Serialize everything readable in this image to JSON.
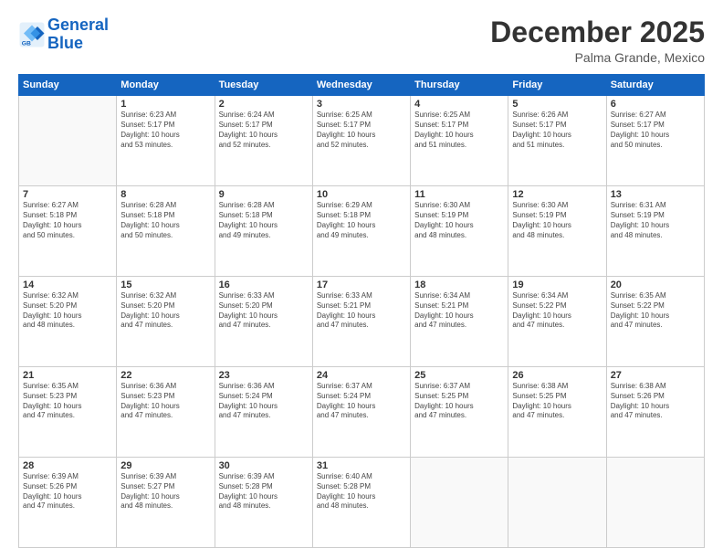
{
  "header": {
    "logo_line1": "General",
    "logo_line2": "Blue",
    "month": "December 2025",
    "location": "Palma Grande, Mexico"
  },
  "weekdays": [
    "Sunday",
    "Monday",
    "Tuesday",
    "Wednesday",
    "Thursday",
    "Friday",
    "Saturday"
  ],
  "weeks": [
    [
      {
        "day": "",
        "info": ""
      },
      {
        "day": "1",
        "info": "Sunrise: 6:23 AM\nSunset: 5:17 PM\nDaylight: 10 hours\nand 53 minutes."
      },
      {
        "day": "2",
        "info": "Sunrise: 6:24 AM\nSunset: 5:17 PM\nDaylight: 10 hours\nand 52 minutes."
      },
      {
        "day": "3",
        "info": "Sunrise: 6:25 AM\nSunset: 5:17 PM\nDaylight: 10 hours\nand 52 minutes."
      },
      {
        "day": "4",
        "info": "Sunrise: 6:25 AM\nSunset: 5:17 PM\nDaylight: 10 hours\nand 51 minutes."
      },
      {
        "day": "5",
        "info": "Sunrise: 6:26 AM\nSunset: 5:17 PM\nDaylight: 10 hours\nand 51 minutes."
      },
      {
        "day": "6",
        "info": "Sunrise: 6:27 AM\nSunset: 5:17 PM\nDaylight: 10 hours\nand 50 minutes."
      }
    ],
    [
      {
        "day": "7",
        "info": "Sunrise: 6:27 AM\nSunset: 5:18 PM\nDaylight: 10 hours\nand 50 minutes."
      },
      {
        "day": "8",
        "info": "Sunrise: 6:28 AM\nSunset: 5:18 PM\nDaylight: 10 hours\nand 50 minutes."
      },
      {
        "day": "9",
        "info": "Sunrise: 6:28 AM\nSunset: 5:18 PM\nDaylight: 10 hours\nand 49 minutes."
      },
      {
        "day": "10",
        "info": "Sunrise: 6:29 AM\nSunset: 5:18 PM\nDaylight: 10 hours\nand 49 minutes."
      },
      {
        "day": "11",
        "info": "Sunrise: 6:30 AM\nSunset: 5:19 PM\nDaylight: 10 hours\nand 48 minutes."
      },
      {
        "day": "12",
        "info": "Sunrise: 6:30 AM\nSunset: 5:19 PM\nDaylight: 10 hours\nand 48 minutes."
      },
      {
        "day": "13",
        "info": "Sunrise: 6:31 AM\nSunset: 5:19 PM\nDaylight: 10 hours\nand 48 minutes."
      }
    ],
    [
      {
        "day": "14",
        "info": "Sunrise: 6:32 AM\nSunset: 5:20 PM\nDaylight: 10 hours\nand 48 minutes."
      },
      {
        "day": "15",
        "info": "Sunrise: 6:32 AM\nSunset: 5:20 PM\nDaylight: 10 hours\nand 47 minutes."
      },
      {
        "day": "16",
        "info": "Sunrise: 6:33 AM\nSunset: 5:20 PM\nDaylight: 10 hours\nand 47 minutes."
      },
      {
        "day": "17",
        "info": "Sunrise: 6:33 AM\nSunset: 5:21 PM\nDaylight: 10 hours\nand 47 minutes."
      },
      {
        "day": "18",
        "info": "Sunrise: 6:34 AM\nSunset: 5:21 PM\nDaylight: 10 hours\nand 47 minutes."
      },
      {
        "day": "19",
        "info": "Sunrise: 6:34 AM\nSunset: 5:22 PM\nDaylight: 10 hours\nand 47 minutes."
      },
      {
        "day": "20",
        "info": "Sunrise: 6:35 AM\nSunset: 5:22 PM\nDaylight: 10 hours\nand 47 minutes."
      }
    ],
    [
      {
        "day": "21",
        "info": "Sunrise: 6:35 AM\nSunset: 5:23 PM\nDaylight: 10 hours\nand 47 minutes."
      },
      {
        "day": "22",
        "info": "Sunrise: 6:36 AM\nSunset: 5:23 PM\nDaylight: 10 hours\nand 47 minutes."
      },
      {
        "day": "23",
        "info": "Sunrise: 6:36 AM\nSunset: 5:24 PM\nDaylight: 10 hours\nand 47 minutes."
      },
      {
        "day": "24",
        "info": "Sunrise: 6:37 AM\nSunset: 5:24 PM\nDaylight: 10 hours\nand 47 minutes."
      },
      {
        "day": "25",
        "info": "Sunrise: 6:37 AM\nSunset: 5:25 PM\nDaylight: 10 hours\nand 47 minutes."
      },
      {
        "day": "26",
        "info": "Sunrise: 6:38 AM\nSunset: 5:25 PM\nDaylight: 10 hours\nand 47 minutes."
      },
      {
        "day": "27",
        "info": "Sunrise: 6:38 AM\nSunset: 5:26 PM\nDaylight: 10 hours\nand 47 minutes."
      }
    ],
    [
      {
        "day": "28",
        "info": "Sunrise: 6:39 AM\nSunset: 5:26 PM\nDaylight: 10 hours\nand 47 minutes."
      },
      {
        "day": "29",
        "info": "Sunrise: 6:39 AM\nSunset: 5:27 PM\nDaylight: 10 hours\nand 48 minutes."
      },
      {
        "day": "30",
        "info": "Sunrise: 6:39 AM\nSunset: 5:28 PM\nDaylight: 10 hours\nand 48 minutes."
      },
      {
        "day": "31",
        "info": "Sunrise: 6:40 AM\nSunset: 5:28 PM\nDaylight: 10 hours\nand 48 minutes."
      },
      {
        "day": "",
        "info": ""
      },
      {
        "day": "",
        "info": ""
      },
      {
        "day": "",
        "info": ""
      }
    ]
  ]
}
